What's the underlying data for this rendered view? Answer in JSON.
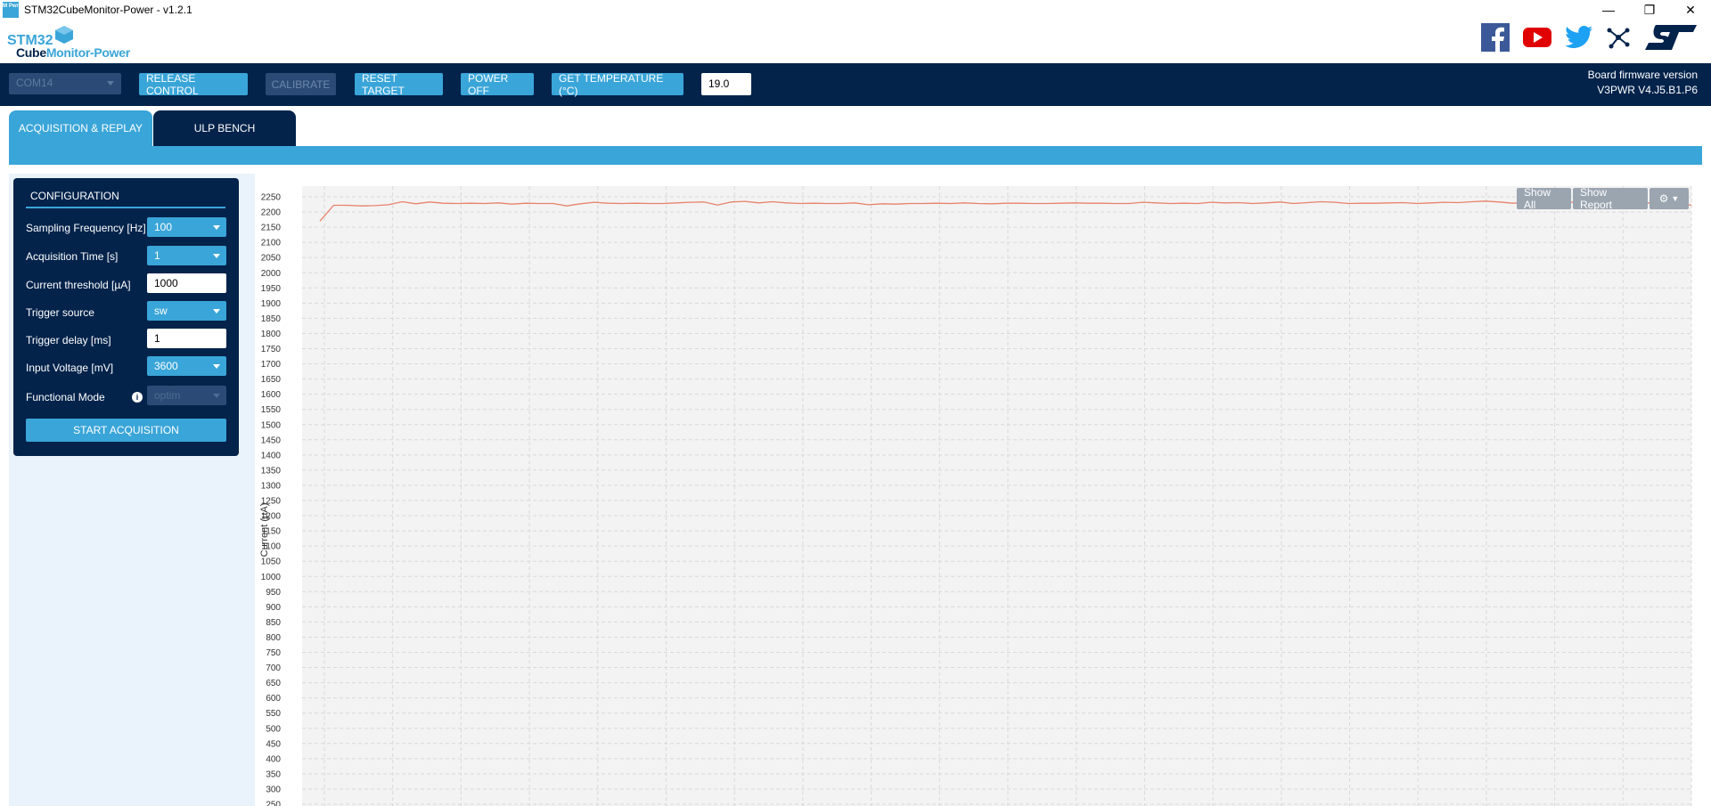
{
  "window": {
    "title": "STM32CubeMonitor-Power - v1.2.1",
    "icon_label": "M Pwr",
    "controls": [
      "minimize",
      "restore",
      "close"
    ]
  },
  "logo": {
    "line1": "STM32",
    "line2a": "Cube",
    "line2b": "Monitor-Power"
  },
  "social": [
    "facebook-icon",
    "youtube-icon",
    "twitter-icon",
    "network-icon",
    "st-logo-icon"
  ],
  "toolbar": {
    "com_port": "COM14",
    "release_control": "RELEASE CONTROL",
    "calibrate": "CALIBRATE",
    "reset_target": "RESET TARGET",
    "power_off": "POWER OFF",
    "get_temperature": "GET TEMPERATURE (°C)",
    "temperature_value": "19.0",
    "fw_label": "Board firmware version",
    "fw_value": "V3PWR V4.J5.B1.P6"
  },
  "tabs": [
    {
      "label": "ACQUISITION & REPLAY",
      "active": true
    },
    {
      "label": "ULP BENCH",
      "active": false
    }
  ],
  "config": {
    "title": "CONFIGURATION",
    "sampling_frequency": {
      "label": "Sampling Frequency [Hz]",
      "value": "100"
    },
    "acquisition_time": {
      "label": "Acquisition Time [s]",
      "value": "1"
    },
    "current_threshold": {
      "label": "Current threshold [µA]",
      "value": "1000"
    },
    "trigger_source": {
      "label": "Trigger source",
      "value": "sw"
    },
    "trigger_delay": {
      "label": "Trigger delay [ms]",
      "value": "1"
    },
    "input_voltage": {
      "label": "Input Voltage [mV]",
      "value": "3600"
    },
    "functional_mode": {
      "label": "Functional Mode",
      "value": "optim"
    },
    "start_button": "START ACQUISITION"
  },
  "chart_controls": {
    "show_all": "Show All",
    "show_report": "Show Report",
    "settings": "gear-icon"
  },
  "colors": {
    "navy": "#03234b",
    "accent": "#3aa5d8",
    "line": "#e8826b"
  },
  "chart_data": {
    "type": "line",
    "ylabel": "Current (µA)",
    "ylim": [
      250,
      2250
    ],
    "ytick_step": 50,
    "grid": true,
    "series": [
      {
        "x": [
          0.0,
          0.01,
          0.02,
          0.03,
          0.04,
          0.05,
          0.06,
          0.07,
          0.08,
          0.09,
          0.1,
          0.11,
          0.12,
          0.13,
          0.14,
          0.15,
          0.16,
          0.17,
          0.18,
          0.19,
          0.2,
          0.21,
          0.22,
          0.23,
          0.24,
          0.25,
          0.26,
          0.27,
          0.28,
          0.29,
          0.3,
          0.31,
          0.32,
          0.33,
          0.34,
          0.35,
          0.36,
          0.37,
          0.38,
          0.39,
          0.4,
          0.41,
          0.42,
          0.43,
          0.44,
          0.45,
          0.46,
          0.47,
          0.48,
          0.49,
          0.5,
          0.51,
          0.52,
          0.53,
          0.54,
          0.55,
          0.56,
          0.57,
          0.58,
          0.59,
          0.6,
          0.61,
          0.62,
          0.63,
          0.64,
          0.65,
          0.66,
          0.67,
          0.68,
          0.69,
          0.7,
          0.71,
          0.72,
          0.73,
          0.74,
          0.75,
          0.76,
          0.77,
          0.78,
          0.79,
          0.8,
          0.81,
          0.82,
          0.83,
          0.84,
          0.85,
          0.86,
          0.87,
          0.88,
          0.89,
          0.9,
          0.91,
          0.92,
          0.93,
          0.94,
          0.95,
          0.96,
          0.97,
          0.98,
          0.99,
          1.0
        ],
        "values": [
          2170,
          2222,
          2222,
          2220,
          2221,
          2224,
          2234,
          2227,
          2233,
          2229,
          2228,
          2229,
          2228,
          2230,
          2226,
          2229,
          2228,
          2228,
          2220,
          2227,
          2232,
          2229,
          2228,
          2229,
          2228,
          2228,
          2230,
          2232,
          2233,
          2223,
          2233,
          2235,
          2230,
          2234,
          2230,
          2228,
          2229,
          2228,
          2228,
          2230,
          2224,
          2227,
          2226,
          2228,
          2228,
          2229,
          2228,
          2230,
          2228,
          2227,
          2229,
          2229,
          2228,
          2228,
          2229,
          2230,
          2229,
          2229,
          2228,
          2228,
          2232,
          2230,
          2228,
          2229,
          2228,
          2232,
          2230,
          2231,
          2228,
          2230,
          2233,
          2228,
          2231,
          2234,
          2232,
          2228,
          2229,
          2229,
          2230,
          2231,
          2228,
          2230,
          2232,
          2231,
          2234,
          2236,
          2233,
          2229,
          2233,
          2228,
          2231,
          2233,
          2230,
          2229,
          2228,
          2232,
          2228,
          2230,
          2231,
          2229,
          2222
        ]
      }
    ]
  }
}
